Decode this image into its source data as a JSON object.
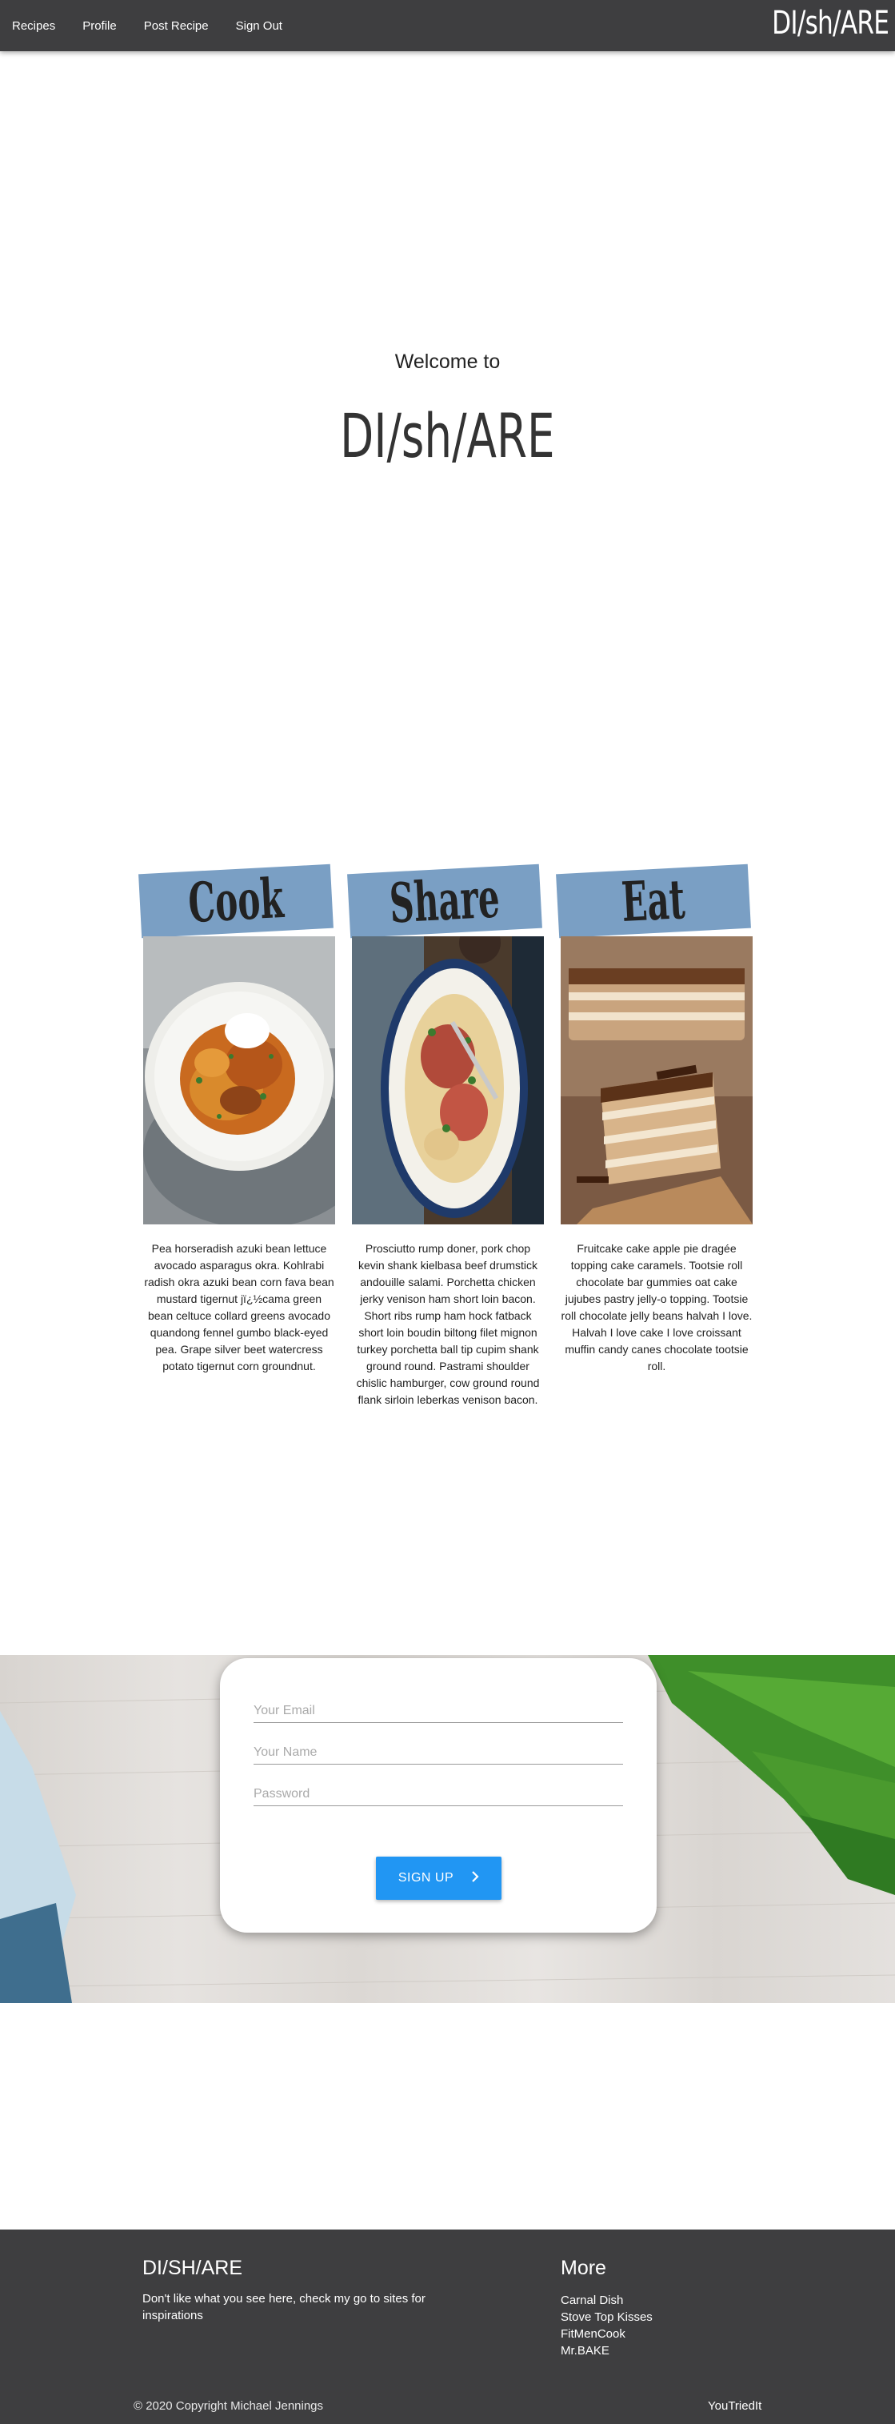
{
  "nav": {
    "links": [
      "Recipes",
      "Profile",
      "Post Recipe",
      "Sign Out"
    ],
    "brand": "DI/sh/ARE"
  },
  "hero": {
    "welcome": "Welcome to",
    "brand": "DI/sh/ARE"
  },
  "cards": [
    {
      "title": "Cook",
      "image": "pasta-dish",
      "text": "Pea horseradish azuki bean lettuce avocado asparagus okra. Kohlrabi radish okra azuki bean corn fava bean mustard tigernut jï¿½cama green bean celtuce collard greens avocado quandong fennel gumbo black-eyed pea. Grape silver beet watercress potato tigernut corn groundnut."
    },
    {
      "title": "Share",
      "image": "penne-platter",
      "text": "Prosciutto rump doner, pork chop kevin shank kielbasa beef drumstick andouille salami. Porchetta chicken jerky venison ham short loin bacon. Short ribs rump ham hock fatback short loin boudin biltong filet mignon turkey porchetta ball tip cupim shank ground round. Pastrami shoulder chislic hamburger, cow ground round flank sirloin leberkas venison bacon."
    },
    {
      "title": "Eat",
      "image": "layer-cake",
      "text": "Fruitcake cake apple pie dragée topping cake caramels. Tootsie roll chocolate bar gummies oat cake jujubes pastry jelly-o topping. Tootsie roll chocolate jelly beans halvah I love. Halvah I love cake I love croissant muffin candy canes chocolate tootsie roll."
    }
  ],
  "signup": {
    "email_placeholder": "Your Email",
    "name_placeholder": "Your Name",
    "password_placeholder": "Password",
    "button_label": "SIGN UP"
  },
  "footer": {
    "title": "DI/SH/ARE",
    "text": "Don't like what you see here, check my go to sites for inspirations",
    "more_title": "More",
    "links": [
      "Carnal Dish",
      "Stove Top Kisses",
      "FitMenCook",
      "Mr.BAKE"
    ],
    "copyright": "© 2020 Copyright Michael Jennings",
    "right_label": "YouTriedIt"
  },
  "colors": {
    "nav_bg": "#3e3e40",
    "banner": "#7a9fc4",
    "button": "#2196f3"
  }
}
